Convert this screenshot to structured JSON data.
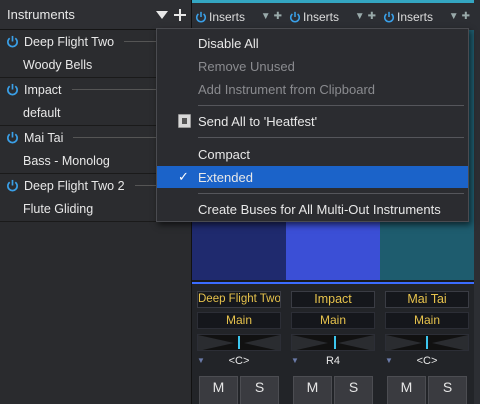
{
  "instruments_panel": {
    "title": "Instruments",
    "items": [
      {
        "name": "Deep Flight Two",
        "preset": "Woody Bells"
      },
      {
        "name": "Impact",
        "preset": "default"
      },
      {
        "name": "Mai Tai",
        "preset": "Bass - Monolog"
      },
      {
        "name": "Deep Flight Two 2",
        "preset": "Flute Gliding"
      }
    ]
  },
  "menu": {
    "disable_all": "Disable All",
    "remove_unused": "Remove Unused",
    "add_from_clipboard": "Add Instrument from Clipboard",
    "send_all": "Send All to 'Heatfest'",
    "compact": "Compact",
    "extended": "Extended",
    "create_buses": "Create Buses for All Multi-Out Instruments"
  },
  "channels": [
    {
      "inserts": "Inserts",
      "name": "Deep Flight Two",
      "output": "Main",
      "pan": "<C>",
      "mute": "M",
      "solo": "S",
      "color": "#1f2a6e"
    },
    {
      "inserts": "Inserts",
      "name": "Impact",
      "output": "Main",
      "pan": "R4",
      "mute": "M",
      "solo": "S",
      "color": "#3b4fd6"
    },
    {
      "inserts": "Inserts",
      "name": "Mai Tai",
      "output": "Main",
      "pan": "<C>",
      "mute": "M",
      "solo": "S",
      "color": "#1e5c6e"
    }
  ],
  "colors": {
    "accent_cyan": "#34a6c2",
    "menu_highlight": "#1b63c9",
    "channel_name_text": "#e6c24c",
    "mute_active": "#e04c4c",
    "solo_active": "#4fb3cf"
  }
}
